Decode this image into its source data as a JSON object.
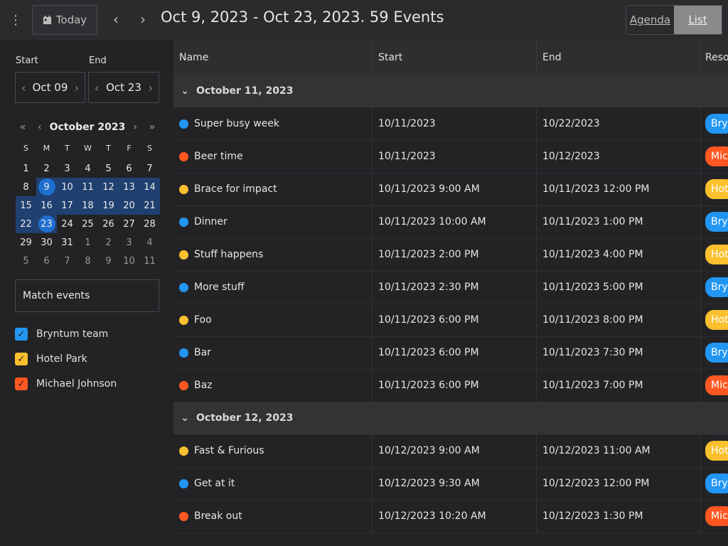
{
  "toolbar": {
    "today_label": "Today",
    "title": "Oct 9, 2023 - Oct 23, 2023. 59 Events",
    "views": [
      {
        "label": "Agenda",
        "active": false
      },
      {
        "label": "List",
        "active": true
      }
    ]
  },
  "sidebar": {
    "start_label": "Start",
    "end_label": "End",
    "start_value": "Oct 09",
    "end_value": "Oct 23",
    "calendar": {
      "month_label": "October 2023",
      "weekdays": [
        "S",
        "M",
        "T",
        "W",
        "T",
        "F",
        "S"
      ],
      "weeks": [
        [
          "1",
          "2",
          "3",
          "4",
          "5",
          "6",
          "7"
        ],
        [
          "8",
          "9",
          "10",
          "11",
          "12",
          "13",
          "14"
        ],
        [
          "15",
          "16",
          "17",
          "18",
          "19",
          "20",
          "21"
        ],
        [
          "22",
          "23",
          "24",
          "25",
          "26",
          "27",
          "28"
        ],
        [
          "29",
          "30",
          "31",
          "1",
          "2",
          "3",
          "4"
        ],
        [
          "5",
          "6",
          "7",
          "8",
          "9",
          "10",
          "11"
        ]
      ]
    },
    "filter_placeholder": "Match events",
    "resources": [
      {
        "name": "Bryntum team",
        "color": "#2196f3"
      },
      {
        "name": "Hotel Park",
        "color": "#fbc02d"
      },
      {
        "name": "Michael Johnson",
        "color": "#ff5722"
      }
    ]
  },
  "grid": {
    "columns": [
      "Name",
      "Start",
      "End",
      "Reso"
    ],
    "groups": [
      {
        "label": "October 11, 2023",
        "rows": [
          {
            "name": "Super busy week",
            "start": "10/11/2023",
            "end": "10/22/2023",
            "color": "#2196f3",
            "resource": "Bry"
          },
          {
            "name": "Beer time",
            "start": "10/11/2023",
            "end": "10/12/2023",
            "color": "#ff5722",
            "resource": "Mic"
          },
          {
            "name": "Brace for impact",
            "start": "10/11/2023 9:00 AM",
            "end": "10/11/2023 12:00 PM",
            "color": "#fbc02d",
            "resource": "Hot"
          },
          {
            "name": "Dinner",
            "start": "10/11/2023 10:00 AM",
            "end": "10/11/2023 1:00 PM",
            "color": "#2196f3",
            "resource": "Bry"
          },
          {
            "name": "Stuff happens",
            "start": "10/11/2023 2:00 PM",
            "end": "10/11/2023 4:00 PM",
            "color": "#fbc02d",
            "resource": "Hot"
          },
          {
            "name": "More stuff",
            "start": "10/11/2023 2:30 PM",
            "end": "10/11/2023 5:00 PM",
            "color": "#2196f3",
            "resource": "Bry"
          },
          {
            "name": "Foo",
            "start": "10/11/2023 6:00 PM",
            "end": "10/11/2023 8:00 PM",
            "color": "#fbc02d",
            "resource": "Hot"
          },
          {
            "name": "Bar",
            "start": "10/11/2023 6:00 PM",
            "end": "10/11/2023 7:30 PM",
            "color": "#2196f3",
            "resource": "Bry"
          },
          {
            "name": "Baz",
            "start": "10/11/2023 6:00 PM",
            "end": "10/11/2023 7:00 PM",
            "color": "#ff5722",
            "resource": "Mic"
          }
        ]
      },
      {
        "label": "October 12, 2023",
        "rows": [
          {
            "name": "Fast & Furious",
            "start": "10/12/2023 9:00 AM",
            "end": "10/12/2023 11:00 AM",
            "color": "#fbc02d",
            "resource": "Hot"
          },
          {
            "name": "Get at it",
            "start": "10/12/2023 9:30 AM",
            "end": "10/12/2023 12:00 PM",
            "color": "#2196f3",
            "resource": "Bry"
          },
          {
            "name": "Break out",
            "start": "10/12/2023 10:20 AM",
            "end": "10/12/2023 1:30 PM",
            "color": "#ff5722",
            "resource": "Mic"
          }
        ]
      }
    ]
  }
}
